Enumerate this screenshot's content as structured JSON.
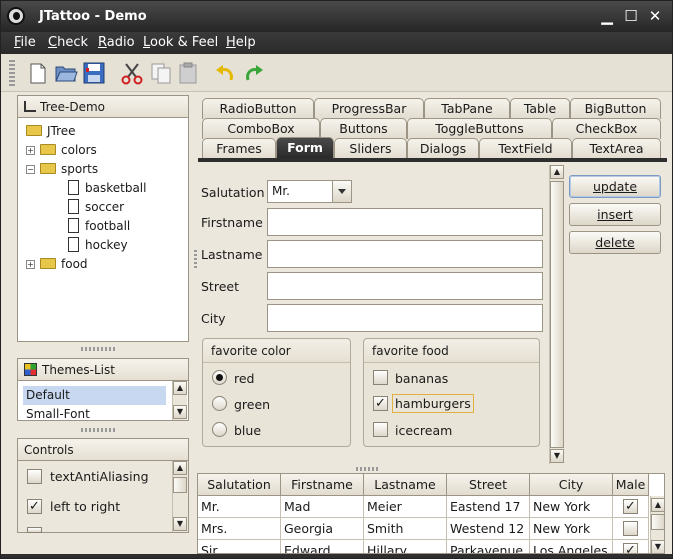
{
  "window": {
    "title": "JTattoo - Demo"
  },
  "menubar": [
    {
      "letter": "F",
      "rest": "ile"
    },
    {
      "letter": "C",
      "rest": "heck"
    },
    {
      "letter": "R",
      "rest": "adio"
    },
    {
      "letter": "L",
      "rest": "ook & Feel"
    },
    {
      "letter": "H",
      "rest": "elp"
    }
  ],
  "toolbar": {
    "icons": [
      "new-document-icon",
      "open-folder-icon",
      "save-icon",
      "cut-icon",
      "copy-icon",
      "paste-icon",
      "undo-icon",
      "redo-icon"
    ]
  },
  "tree": {
    "title": "Tree-Demo",
    "root": "JTree",
    "nodes": [
      {
        "label": "colors",
        "expanded": false
      },
      {
        "label": "sports",
        "expanded": true,
        "children": [
          "basketball",
          "soccer",
          "football",
          "hockey"
        ]
      },
      {
        "label": "food",
        "expanded": false
      }
    ]
  },
  "themes": {
    "title": "Themes-List",
    "items": [
      "Default",
      "Small-Font"
    ],
    "selected": "Default"
  },
  "controls": {
    "title": "Controls",
    "items": [
      {
        "label": "textAntiAliasing",
        "checked": false
      },
      {
        "label": "left to right",
        "checked": true
      }
    ]
  },
  "tabs": {
    "row1": [
      "RadioButton",
      "ProgressBar",
      "TabPane",
      "Table",
      "BigButton"
    ],
    "row2": [
      "ComboBox",
      "Buttons",
      "ToggleButtons",
      "CheckBox"
    ],
    "row3": [
      "Frames",
      "Form",
      "Sliders",
      "Dialogs",
      "TextField",
      "TextArea"
    ],
    "active": "Form"
  },
  "form": {
    "salutation_label": "Salutation",
    "salutation_value": "Mr.",
    "firstname_label": "Firstname",
    "firstname_value": "",
    "lastname_label": "Lastname",
    "lastname_value": "",
    "street_label": "Street",
    "street_value": "",
    "city_label": "City",
    "city_value": "",
    "color_group": {
      "title": "favorite color",
      "options": [
        "red",
        "green",
        "blue"
      ],
      "selected": "red"
    },
    "food_group": {
      "title": "favorite food",
      "options": [
        {
          "label": "bananas",
          "checked": false
        },
        {
          "label": "hamburgers",
          "checked": true
        },
        {
          "label": "icecream",
          "checked": false
        }
      ]
    }
  },
  "actions": {
    "update": "update",
    "insert": "insert",
    "delete": "delete"
  },
  "table": {
    "columns": [
      "Salutation",
      "Firstname",
      "Lastname",
      "Street",
      "City",
      "Male"
    ],
    "rows": [
      {
        "salutation": "Mr.",
        "firstname": "Mad",
        "lastname": "Meier",
        "street": "Eastend 17",
        "city": "New York",
        "male": true
      },
      {
        "salutation": "Mrs.",
        "firstname": "Georgia",
        "lastname": "Smith",
        "street": "Westend 12",
        "city": "New York",
        "male": false
      },
      {
        "salutation": "Sir",
        "firstname": "Edward",
        "lastname": "Hillary",
        "street": "Parkavenue",
        "city": "Los Angeles",
        "male": true
      }
    ]
  }
}
